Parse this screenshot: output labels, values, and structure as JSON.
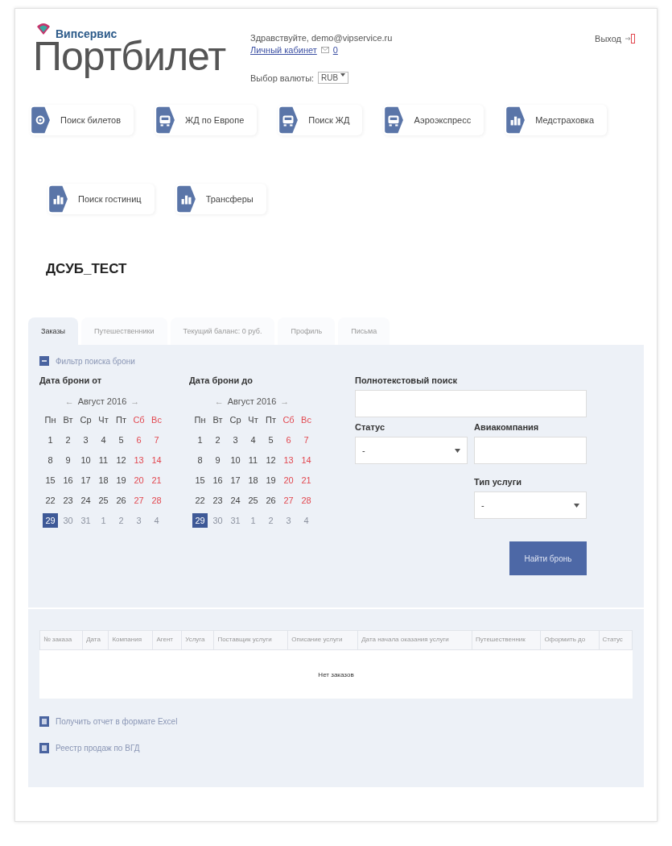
{
  "logo": {
    "brand": "Випсервис",
    "name": "Портбилет"
  },
  "user": {
    "greeting": "Здравствуйте, demo@vipservice.ru",
    "cabinet_link": "Личный кабинет",
    "messages": "0",
    "currency_label": "Выбор валюты:",
    "currency": "RUB",
    "logout": "Выход"
  },
  "nav": [
    {
      "label": "Поиск билетов",
      "kind": "gear"
    },
    {
      "label": "ЖД по Европе",
      "kind": "train"
    },
    {
      "label": "Поиск ЖД",
      "kind": "train"
    },
    {
      "label": "Аэроэкспресс",
      "kind": "train"
    },
    {
      "label": "Медстраховка",
      "kind": "chart"
    },
    {
      "label": "Поиск гостиниц",
      "kind": "chart"
    },
    {
      "label": "Трансферы",
      "kind": "chart"
    }
  ],
  "company": "ДСУБ_ТЕСТ",
  "tabs": [
    {
      "label": "Заказы",
      "selected": true
    },
    {
      "label": "Путешественники",
      "selected": false
    },
    {
      "label": "Текущий баланс: 0 руб.",
      "selected": false
    },
    {
      "label": "Профиль",
      "selected": false
    },
    {
      "label": "Письма",
      "selected": false
    }
  ],
  "filter": {
    "toggle": "Фильтр поиска брони",
    "expanded": true,
    "calendars": [
      {
        "label": "Дата брони от",
        "month": "Август 2016",
        "prev": "←",
        "next": "→",
        "weekdays": [
          {
            "label": "Пн",
            "weekend": false
          },
          {
            "label": "Вт",
            "weekend": false
          },
          {
            "label": "Ср",
            "weekend": false
          },
          {
            "label": "Чт",
            "weekend": false
          },
          {
            "label": "Пт",
            "weekend": false
          },
          {
            "label": "Сб",
            "weekend": true
          },
          {
            "label": "Вс",
            "weekend": true
          }
        ],
        "days": [
          {
            "label": "1",
            "kind": "normal",
            "selected": false
          },
          {
            "label": "2",
            "kind": "normal",
            "selected": false
          },
          {
            "label": "3",
            "kind": "normal",
            "selected": false
          },
          {
            "label": "4",
            "kind": "normal",
            "selected": false
          },
          {
            "label": "5",
            "kind": "normal",
            "selected": false
          },
          {
            "label": "6",
            "kind": "weekend",
            "selected": false
          },
          {
            "label": "7",
            "kind": "weekend",
            "selected": false
          },
          {
            "label": "8",
            "kind": "normal",
            "selected": false
          },
          {
            "label": "9",
            "kind": "normal",
            "selected": false
          },
          {
            "label": "10",
            "kind": "normal",
            "selected": false
          },
          {
            "label": "11",
            "kind": "normal",
            "selected": false
          },
          {
            "label": "12",
            "kind": "normal",
            "selected": false
          },
          {
            "label": "13",
            "kind": "weekend",
            "selected": false
          },
          {
            "label": "14",
            "kind": "weekend",
            "selected": false
          },
          {
            "label": "15",
            "kind": "normal",
            "selected": false
          },
          {
            "label": "16",
            "kind": "normal",
            "selected": false
          },
          {
            "label": "17",
            "kind": "normal",
            "selected": false
          },
          {
            "label": "18",
            "kind": "normal",
            "selected": false
          },
          {
            "label": "19",
            "kind": "normal",
            "selected": false
          },
          {
            "label": "20",
            "kind": "weekend",
            "selected": false
          },
          {
            "label": "21",
            "kind": "weekend",
            "selected": false
          },
          {
            "label": "22",
            "kind": "normal",
            "selected": false
          },
          {
            "label": "23",
            "kind": "normal",
            "selected": false
          },
          {
            "label": "24",
            "kind": "normal",
            "selected": false
          },
          {
            "label": "25",
            "kind": "normal",
            "selected": false
          },
          {
            "label": "26",
            "kind": "normal",
            "selected": false
          },
          {
            "label": "27",
            "kind": "weekend",
            "selected": false
          },
          {
            "label": "28",
            "kind": "weekend",
            "selected": false
          },
          {
            "label": "29",
            "kind": "normal",
            "selected": true
          },
          {
            "label": "30",
            "kind": "other",
            "selected": false
          },
          {
            "label": "31",
            "kind": "other",
            "selected": false
          },
          {
            "label": "1",
            "kind": "other",
            "selected": false
          },
          {
            "label": "2",
            "kind": "other",
            "selected": false
          },
          {
            "label": "3",
            "kind": "other",
            "selected": false
          },
          {
            "label": "4",
            "kind": "other",
            "selected": false
          }
        ]
      },
      {
        "label": "Дата брони до",
        "month": "Август 2016",
        "prev": "←",
        "next": "→",
        "weekdays": [
          {
            "label": "Пн",
            "weekend": false
          },
          {
            "label": "Вт",
            "weekend": false
          },
          {
            "label": "Ср",
            "weekend": false
          },
          {
            "label": "Чт",
            "weekend": false
          },
          {
            "label": "Пт",
            "weekend": false
          },
          {
            "label": "Сб",
            "weekend": true
          },
          {
            "label": "Вс",
            "weekend": true
          }
        ],
        "days": [
          {
            "label": "1",
            "kind": "normal",
            "selected": false
          },
          {
            "label": "2",
            "kind": "normal",
            "selected": false
          },
          {
            "label": "3",
            "kind": "normal",
            "selected": false
          },
          {
            "label": "4",
            "kind": "normal",
            "selected": false
          },
          {
            "label": "5",
            "kind": "normal",
            "selected": false
          },
          {
            "label": "6",
            "kind": "weekend",
            "selected": false
          },
          {
            "label": "7",
            "kind": "weekend",
            "selected": false
          },
          {
            "label": "8",
            "kind": "normal",
            "selected": false
          },
          {
            "label": "9",
            "kind": "normal",
            "selected": false
          },
          {
            "label": "10",
            "kind": "normal",
            "selected": false
          },
          {
            "label": "11",
            "kind": "normal",
            "selected": false
          },
          {
            "label": "12",
            "kind": "normal",
            "selected": false
          },
          {
            "label": "13",
            "kind": "weekend",
            "selected": false
          },
          {
            "label": "14",
            "kind": "weekend",
            "selected": false
          },
          {
            "label": "15",
            "kind": "normal",
            "selected": false
          },
          {
            "label": "16",
            "kind": "normal",
            "selected": false
          },
          {
            "label": "17",
            "kind": "normal",
            "selected": false
          },
          {
            "label": "18",
            "kind": "normal",
            "selected": false
          },
          {
            "label": "19",
            "kind": "normal",
            "selected": false
          },
          {
            "label": "20",
            "kind": "weekend",
            "selected": false
          },
          {
            "label": "21",
            "kind": "weekend",
            "selected": false
          },
          {
            "label": "22",
            "kind": "normal",
            "selected": false
          },
          {
            "label": "23",
            "kind": "normal",
            "selected": false
          },
          {
            "label": "24",
            "kind": "normal",
            "selected": false
          },
          {
            "label": "25",
            "kind": "normal",
            "selected": false
          },
          {
            "label": "26",
            "kind": "normal",
            "selected": false
          },
          {
            "label": "27",
            "kind": "weekend",
            "selected": false
          },
          {
            "label": "28",
            "kind": "weekend",
            "selected": false
          },
          {
            "label": "29",
            "kind": "normal",
            "selected": true
          },
          {
            "label": "30",
            "kind": "other",
            "selected": false
          },
          {
            "label": "31",
            "kind": "other",
            "selected": false
          },
          {
            "label": "1",
            "kind": "other",
            "selected": false
          },
          {
            "label": "2",
            "kind": "other",
            "selected": false
          },
          {
            "label": "3",
            "kind": "other",
            "selected": false
          },
          {
            "label": "4",
            "kind": "other",
            "selected": false
          }
        ]
      }
    ],
    "fulltext_label": "Полнотекстовый поиск",
    "status_label": "Статус",
    "status_value": "-",
    "airline_label": "Авиакомпания",
    "service_type_label": "Тип услуги",
    "service_type_value": "-",
    "search_button": "Найти бронь"
  },
  "table": {
    "columns": [
      "№ заказа",
      "Дата",
      "Компания",
      "Агент",
      "Услуга",
      "Поставщик услуги",
      "Описание услуги",
      "Дата начала оказания услуги",
      "Путешественник",
      "Оформить до",
      "Статус"
    ],
    "empty": "Нет заказов"
  },
  "reports": [
    "Получить отчет в формате Excel",
    "Реестр продаж по ВГД"
  ]
}
